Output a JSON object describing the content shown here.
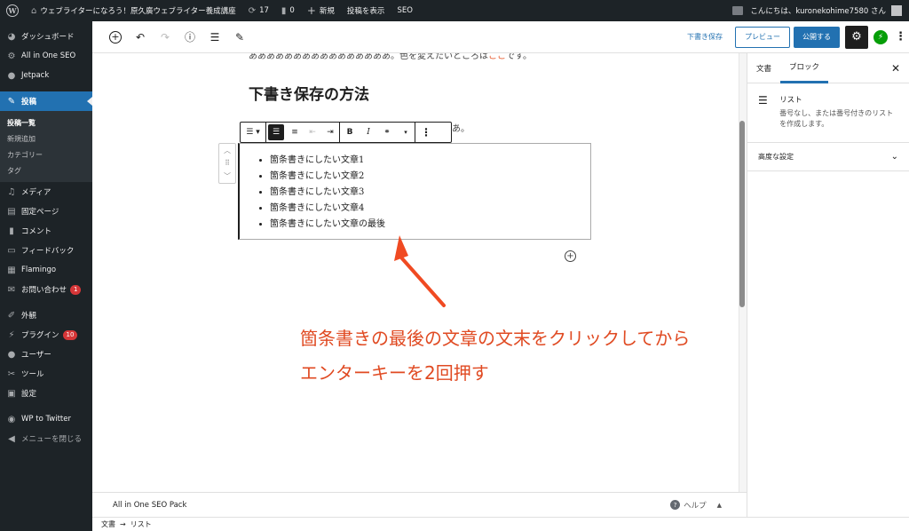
{
  "admin_bar": {
    "site_name": "ウェブライターになろう！原久廣ウェブライター養成講座",
    "updates_count": "17",
    "comments_count": "0",
    "new_label": "新規",
    "view_post_label": "投稿を表示",
    "seo_label": "SEO",
    "greeting": "こんにちは、kuronekohime7580 さん"
  },
  "sidebar": {
    "items": [
      {
        "label": "ダッシュボード",
        "icon": "dashboard-icon"
      },
      {
        "label": "All in One SEO",
        "icon": "gear-icon"
      },
      {
        "label": "Jetpack",
        "icon": "jetpack-icon"
      },
      {
        "label": "投稿",
        "icon": "pin-icon"
      },
      {
        "label": "メディア",
        "icon": "media-icon"
      },
      {
        "label": "固定ページ",
        "icon": "page-icon"
      },
      {
        "label": "コメント",
        "icon": "comment-icon"
      },
      {
        "label": "フィードバック",
        "icon": "feedback-icon"
      },
      {
        "label": "Flamingo",
        "icon": "flamingo-icon"
      },
      {
        "label": "お問い合わせ",
        "icon": "mail-icon",
        "badge": "1"
      },
      {
        "label": "外観",
        "icon": "appearance-icon"
      },
      {
        "label": "プラグイン",
        "icon": "plugin-icon",
        "badge": "10"
      },
      {
        "label": "ユーザー",
        "icon": "user-icon"
      },
      {
        "label": "ツール",
        "icon": "tool-icon"
      },
      {
        "label": "設定",
        "icon": "settings-icon"
      },
      {
        "label": "WP to Twitter",
        "icon": "twitter-icon"
      },
      {
        "label": "メニューを閉じる",
        "icon": "collapse-icon"
      }
    ],
    "submenu": [
      "投稿一覧",
      "新規追加",
      "カテゴリー",
      "タグ"
    ]
  },
  "editor_header": {
    "save_draft": "下書き保存",
    "preview": "プレビュー",
    "publish": "公開する"
  },
  "content": {
    "para_top": "ああああああああああああああああ。色を変えたいところは",
    "para_top_highlight": "ここ",
    "para_top_end": "です。",
    "heading": "下書き保存の方法",
    "para_tail": "あ。",
    "list_items": [
      "箇条書きにしたい文章1",
      "箇条書きにしたい文章2",
      "箇条書きにしたい文章3",
      "箇条書きにしたい文章4",
      "箇条書きにしたい文章の最後"
    ],
    "annotation": "箇条書きの最後の文章の文末をクリックしてからエンターキーを2回押す",
    "annotation_color": "#e04a22"
  },
  "panel": {
    "tab_document": "文書",
    "tab_block": "ブロック",
    "block_title": "リスト",
    "block_desc": "番号なし、または番号付きのリストを作成します。",
    "advanced": "高度な設定"
  },
  "metabox": {
    "title": "All in One SEO Pack",
    "help": "ヘルプ"
  },
  "breadcrumb": {
    "root": "文書",
    "arrow": "→",
    "current": "リスト"
  }
}
